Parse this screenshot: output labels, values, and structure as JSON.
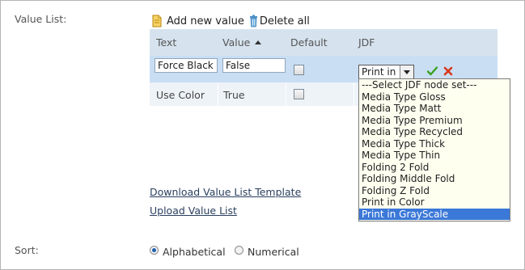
{
  "value_list_label": "Value List:",
  "toolbar": {
    "add_label": "Add new value",
    "delete_label": "Delete all"
  },
  "table": {
    "headers": [
      "Text",
      "Value",
      "Default",
      "JDF"
    ],
    "sort_column": "Value",
    "edit_row": {
      "text": "Force Black &",
      "value": "False",
      "default_checked": false,
      "jdf_selected": "Print in"
    },
    "rows": [
      {
        "text": "Use Color",
        "value": "True",
        "default_checked": false
      }
    ]
  },
  "jdf_options": [
    "---Select JDF node set---",
    "Media Type Gloss",
    "Media Type Matt",
    "Media Type Premium",
    "Media Type Recycled",
    "Media Type Thick",
    "Media Type Thin",
    "Folding 2 Fold",
    "Folding Middle Fold",
    "Folding Z Fold",
    "Print in Color",
    "Print in GrayScale"
  ],
  "jdf_highlighted": "Print in GrayScale",
  "links": {
    "download": "Download Value List Template",
    "upload": "Upload Value List"
  },
  "sort": {
    "label": "Sort:",
    "options": [
      "Alphabetical",
      "Numerical"
    ],
    "selected": "Alphabetical"
  },
  "colors": {
    "header_bg": "#d6e3ee",
    "edit_row_bg": "#c9def3",
    "highlight": "#3b78d8",
    "accept_green": "#3aa020",
    "cancel_red": "#d9361b"
  },
  "icons": {
    "add": "document-add-icon",
    "delete": "trash-icon",
    "accept": "checkmark-icon",
    "cancel": "x-icon"
  }
}
